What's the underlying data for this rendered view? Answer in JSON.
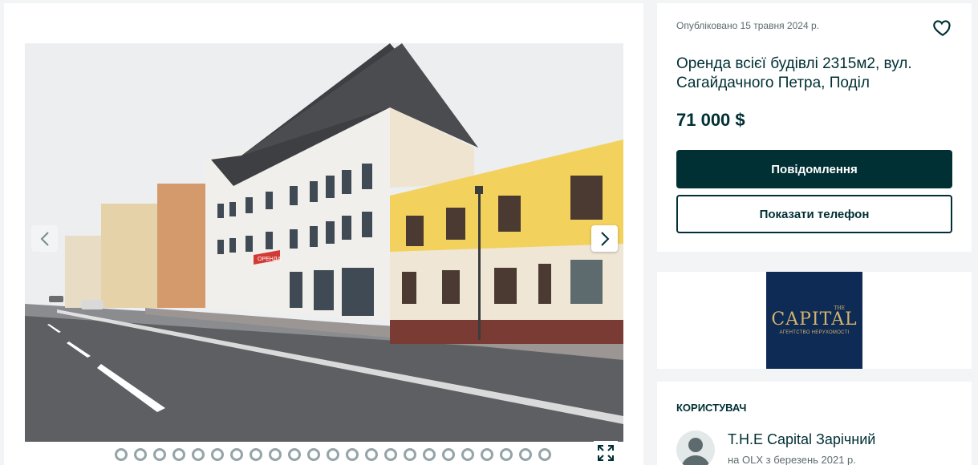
{
  "gallery": {
    "photo_alt": "",
    "prev_icon": "chevron-left-icon",
    "next_icon": "chevron-right-icon",
    "dot_count": 23,
    "fullscreen_icon": "expand-icon",
    "sign_text": "ОРЕНДА"
  },
  "listing": {
    "published": "Опубліковано 15 травня 2024 р.",
    "title": "Оренда всієї будівлі 2315м2, вул. Сагайдачного Петра, Поділ",
    "price": "71 000 $",
    "message_button": "Повідомлення",
    "phone_button": "Показати телефон",
    "favorite_icon": "heart-icon"
  },
  "agency_logo": {
    "the": "THE",
    "name": "CAPITAL",
    "subtitle": "АГЕНТСТВО НЕРУХОМОСТІ"
  },
  "user": {
    "heading": "КОРИСТУВАЧ",
    "name": "Т.Н.Е Capital Зарічний",
    "since": "на OLX з березень 2021 р."
  },
  "colors": {
    "primary": "#002f34",
    "background": "#f2f4f5",
    "dot_border": "#94a4a8",
    "logo_bg": "#0d2b55",
    "logo_gold": "#d8b36a"
  }
}
